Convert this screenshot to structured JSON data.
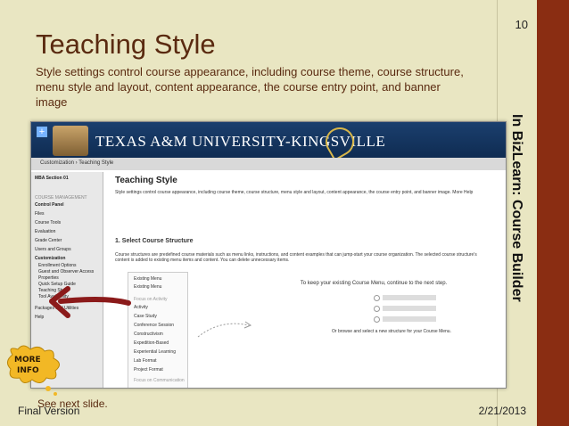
{
  "slide": {
    "number": "10",
    "title": "Teaching Style",
    "subtitle": "Style settings control course appearance, including course theme, course structure, menu style and layout, content appearance, the course entry point, and banner image",
    "side_title": "In BizLearn: Course Builder",
    "more_info_badge": "MORE INFO",
    "see_next": "See next slide.",
    "footer_left": "Final Version",
    "footer_right": "2/21/2013"
  },
  "screenshot": {
    "banner_text": "TEXAS A&M UNIVERSITY-KINGSVILLE",
    "breadcrumb": "Customization  ›  Teaching Style",
    "page_title": "Teaching Style",
    "page_desc": "Style settings control course appearance, including course theme, course structure, menu style and layout, content appearance, the course entry point, and banner image. More Help",
    "section": "1.  Select Course Structure",
    "section_desc": "Course structures are predefined course materials such as menu links, instructions, and content examples that can jump-start your course organization. The selected course structure's content is added to existing menu items and content. You can delete unnecessary items.",
    "keep_menu_text": "To keep your existing Course Menu, continue to the next step.",
    "browse_text": "Or browse and select a new structure for your Course Menu.",
    "sidebar": [
      "MBA Section 01",
      "COURSE MANAGEMENT",
      "Control Panel",
      "Files",
      "Course Tools",
      "Evaluation",
      "Grade Center",
      "Users and Groups",
      "Customization",
      "Enrollment Options",
      "Guest and Observer Access",
      "Properties",
      "Quick Setup Guide",
      "Teaching Style",
      "Tool Availability",
      "Packages and Utilities",
      "Help"
    ],
    "menu_list": [
      "Existing Menu",
      "Existing Menu",
      "Focus on Activity",
      "Activity",
      "Case Study",
      "Conference Session",
      "Constructivism",
      "Expedition-Based",
      "Experiential Learning",
      "Lab Format",
      "Project Format",
      "Focus on Communication"
    ]
  }
}
